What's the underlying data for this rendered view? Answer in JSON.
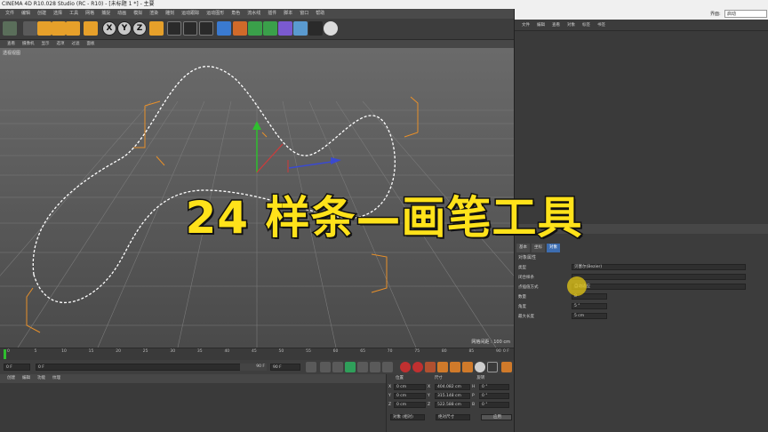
{
  "window": {
    "title": "CINEMA 4D R10.028 Studio (RC - R10) - [未标题 1 *] - 主要"
  },
  "menubar": {
    "items": [
      "文件",
      "编辑",
      "创建",
      "选择",
      "工具",
      "网格",
      "捕捉",
      "动画",
      "模拟",
      "渲染",
      "雕刻",
      "运动跟踪",
      "运动图形",
      "角色",
      "流水线",
      "插件",
      "脚本",
      "窗口",
      "帮助"
    ]
  },
  "toolbar": {
    "x": "X",
    "y": "Y",
    "z": "Z"
  },
  "viewport": {
    "menu": [
      "查看",
      "摄像机",
      "显示",
      "选项",
      "过滤",
      "面板"
    ],
    "label": "透视视图",
    "scale": "网格间距 : 100 cm"
  },
  "timeline": {
    "ticks": [
      "0",
      "5",
      "10",
      "15",
      "20",
      "25",
      "30",
      "35",
      "40",
      "45",
      "50",
      "55",
      "60",
      "65",
      "70",
      "75",
      "80",
      "85",
      "90"
    ],
    "end": "0 F"
  },
  "playbar": {
    "start": "0 F",
    "current": "0 F",
    "end": "90 F",
    "end2": "90 F"
  },
  "materials": {
    "menu": [
      "创建",
      "编辑",
      "功能",
      "纹理"
    ]
  },
  "coords": {
    "headers": [
      "位置",
      "尺寸",
      "旋转"
    ],
    "rows": [
      {
        "axis": "X",
        "pos": "0 cm",
        "size": "404.082 cm",
        "rot_axis": "H",
        "rot": "0 °"
      },
      {
        "axis": "Y",
        "pos": "0 cm",
        "size": "315.148 cm",
        "rot_axis": "P",
        "rot": "0 °"
      },
      {
        "axis": "Z",
        "pos": "0 cm",
        "size": "522.588 cm",
        "rot_axis": "B",
        "rot": "0 °"
      }
    ],
    "mode": "对象 (相对)",
    "size_mode": "绝对尺寸",
    "apply": "应用"
  },
  "right_panel": {
    "top_label": "界面:",
    "top_value": "启动",
    "menu": [
      "文件",
      "编辑",
      "查看",
      "对象",
      "标签",
      "书签"
    ],
    "attr_tabs": [
      "基本",
      "坐标",
      "对象"
    ],
    "attr_section": "对象属性",
    "attr_rows": [
      {
        "label": "类型",
        "value": "贝塞尔(Bezier)"
      },
      {
        "label": "闭合样条",
        "value": ""
      },
      {
        "label": "点插值方式",
        "value": "自动适应"
      },
      {
        "label": "数量",
        "value": "8"
      },
      {
        "label": "角度",
        "value": "5 °"
      },
      {
        "label": "最大长度",
        "value": "5 cm"
      }
    ]
  },
  "overlay": {
    "text": "24 样条—画笔工具"
  },
  "colors": {
    "overlay_text": "#ffe21a",
    "accent_blue": "#3d6db0",
    "spline": "#ffffff",
    "bbox": "#e8902a"
  }
}
